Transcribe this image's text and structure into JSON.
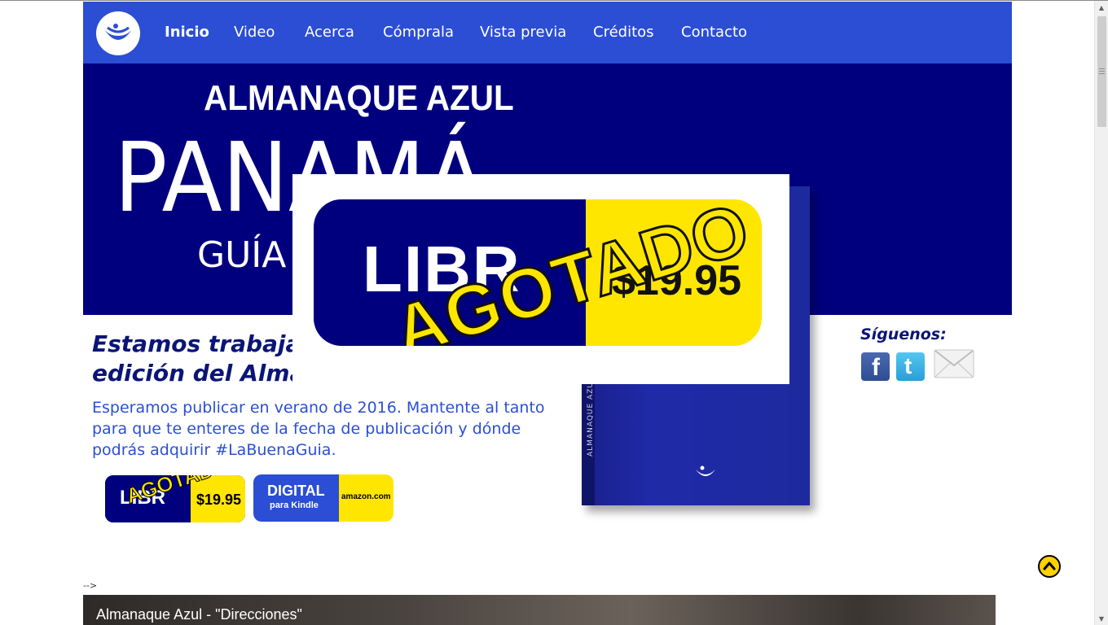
{
  "nav": {
    "items": [
      {
        "label": "Inicio",
        "active": true
      },
      {
        "label": "Video"
      },
      {
        "label": "Acerca"
      },
      {
        "label": "Cómprala"
      },
      {
        "label": "Vista previa"
      },
      {
        "label": "Créditos"
      },
      {
        "label": "Contacto"
      }
    ]
  },
  "hero": {
    "small_title": "ALMANAQUE AZUL",
    "big_title": "PANAMÁ",
    "subtitle": "GUÍA"
  },
  "book": {
    "spine_text": "ALMANAQUE AZUL"
  },
  "main": {
    "heading_line1": "Estamos trabajar",
    "heading_line2": "edición del Alma",
    "body": "Esperamos publicar en verano de 2016. Mantente al tanto para que te enteres de la fecha de publicación y dónde podrás adquirir #LaBuenaGuia."
  },
  "buttons": {
    "libro": {
      "label": "LIBR",
      "price": "$19.95",
      "stamp": "AGOTADO"
    },
    "digital": {
      "label": "DIGITAL",
      "sublabel": "para Kindle",
      "store": "amazon.com"
    }
  },
  "social": {
    "title": "Síguenos:",
    "icons": [
      "facebook-icon",
      "twitter-icon",
      "email-icon"
    ]
  },
  "popup": {
    "label": "LIBR",
    "price": "$19.95",
    "stamp": "AGOTADO"
  },
  "comment_tail": "-->",
  "video": {
    "title": "Almanaque Azul - \"Direcciones\""
  },
  "colors": {
    "nav_blue": "#2b4ed4",
    "hero_navy": "#00007f",
    "accent_yellow": "#ffe600",
    "heading_navy": "#0a1577"
  }
}
